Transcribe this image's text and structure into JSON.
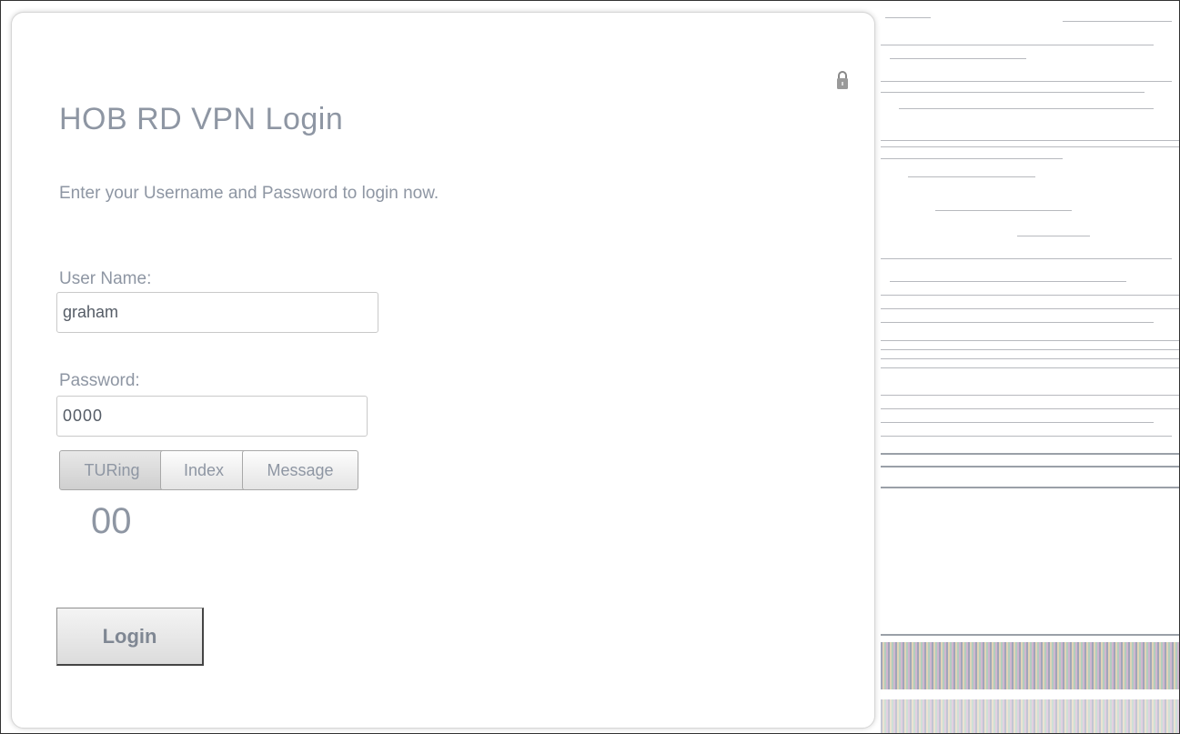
{
  "title": "HOB RD VPN Login",
  "subtitle": "Enter your Username and Password to login now.",
  "form": {
    "username_label": "User Name:",
    "username_value": "graham",
    "password_label": "Password:",
    "password_value": "0000"
  },
  "buttons": {
    "turing": "TURing",
    "index": "Index",
    "message": "Message",
    "login": "Login"
  },
  "counter": "00",
  "icons": {
    "lock": "lock-icon"
  },
  "colors": {
    "text": "#8e96a3",
    "border": "#c9c9c9"
  }
}
